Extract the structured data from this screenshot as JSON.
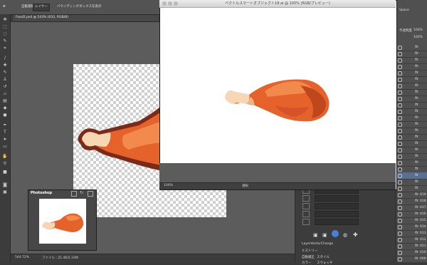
{
  "options": {
    "transform_label": "自動選択",
    "layer_select": "レイヤー",
    "bounding_label": "バウンディングボックスを表示"
  },
  "document": {
    "tab_label": "Food2.psd @ 543% (032, RGB/8)"
  },
  "preview": {
    "title": "ベクトルスマートオブジェクト18.ai @ 100% (RGB/プレビュー)",
    "zoom": "100%",
    "status_label": "選択"
  },
  "navigator": {
    "title": "Photoshop"
  },
  "statusbar": {
    "zoom": "544.72%",
    "file_info": "ファイル : 21.4K/2.33M"
  },
  "right_panels": {
    "panel_label": "Space",
    "opacity_label": "不透明度",
    "opacity_value": "100%",
    "fill_value": "100%",
    "fx_symbol": "fx",
    "actions_title_1": "LayerVectorChange",
    "actions_title_2": "ヒストリー",
    "actions_title_3": "自動補正",
    "actions_title_4": "カラー",
    "actions_sub_1": "スタイル",
    "actions_sub_2": "スウォッチ",
    "layer_numbers": [
      "019",
      "018",
      "017",
      "016",
      "015",
      "014",
      "013",
      "012",
      "011",
      "010",
      "009"
    ]
  },
  "colors": {
    "meat_main": "#e5622b",
    "meat_shadow": "#c0461e",
    "meat_highlight": "#f28a4d",
    "bone": "#f7d6b4",
    "outline_dark": "#7a2a18"
  }
}
